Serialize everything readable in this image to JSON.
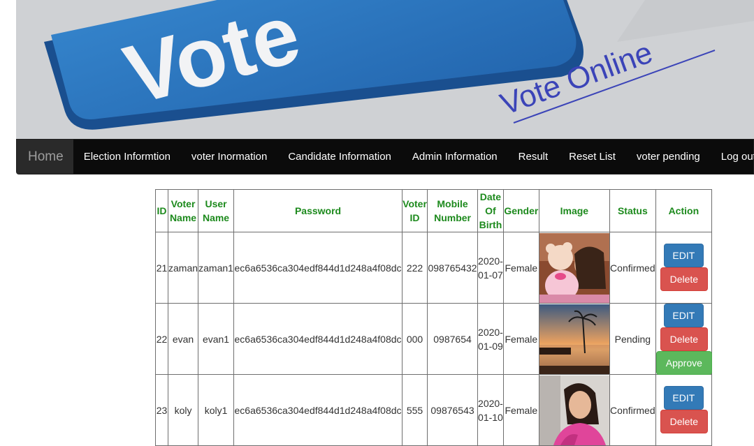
{
  "banner": {
    "text_big": "Vote",
    "text_small": "Vote Online"
  },
  "nav": {
    "brand": "Home",
    "items": [
      "Election Informtion",
      "voter Inormation",
      "Candidate Information",
      "Admin Information",
      "Result",
      "Reset List",
      "voter pending",
      "Log out"
    ]
  },
  "table": {
    "headers": {
      "id": "ID",
      "voter_name": "Voter Name",
      "user_name": "User Name",
      "password": "Password",
      "voter_id": "Voter ID",
      "mobile": "Mobile Number",
      "dob": "Date Of Birth",
      "gender": "Gender",
      "image": "Image",
      "status": "Status",
      "action": "Action"
    },
    "rows": [
      {
        "id": "21",
        "voter_name": "zaman",
        "user_name": "zaman1",
        "password": "ec6a6536ca304edf844d1d248a4f08dc",
        "voter_id": "222",
        "mobile": "098765432",
        "dob": "2020-01-07",
        "gender": "Female",
        "image": "photo-girl-with-teddy-bear",
        "status": "Confirmed"
      },
      {
        "id": "22",
        "voter_name": "evan",
        "user_name": "evan1",
        "password": "ec6a6536ca304edf844d1d248a4f08dc",
        "voter_id": "000",
        "mobile": "0987654",
        "dob": "2020-01-09",
        "gender": "Female",
        "image": "photo-beach-sunset",
        "status": "Pending"
      },
      {
        "id": "23",
        "voter_name": "koly",
        "user_name": "koly1",
        "password": "ec6a6536ca304edf844d1d248a4f08dc",
        "voter_id": "555",
        "mobile": "09876543",
        "dob": "2020-01-10",
        "gender": "Female",
        "image": "photo-girl-selfie",
        "status": "Confirmed"
      }
    ]
  },
  "actions": {
    "edit": "EDIT",
    "delete": "Delete",
    "approve": "Approve"
  },
  "colors": {
    "navbar": "#0b0b0b",
    "header_text": "#1d8a1d",
    "edit": "#337ab7",
    "delete": "#d9534f",
    "approve": "#5cb85c"
  }
}
